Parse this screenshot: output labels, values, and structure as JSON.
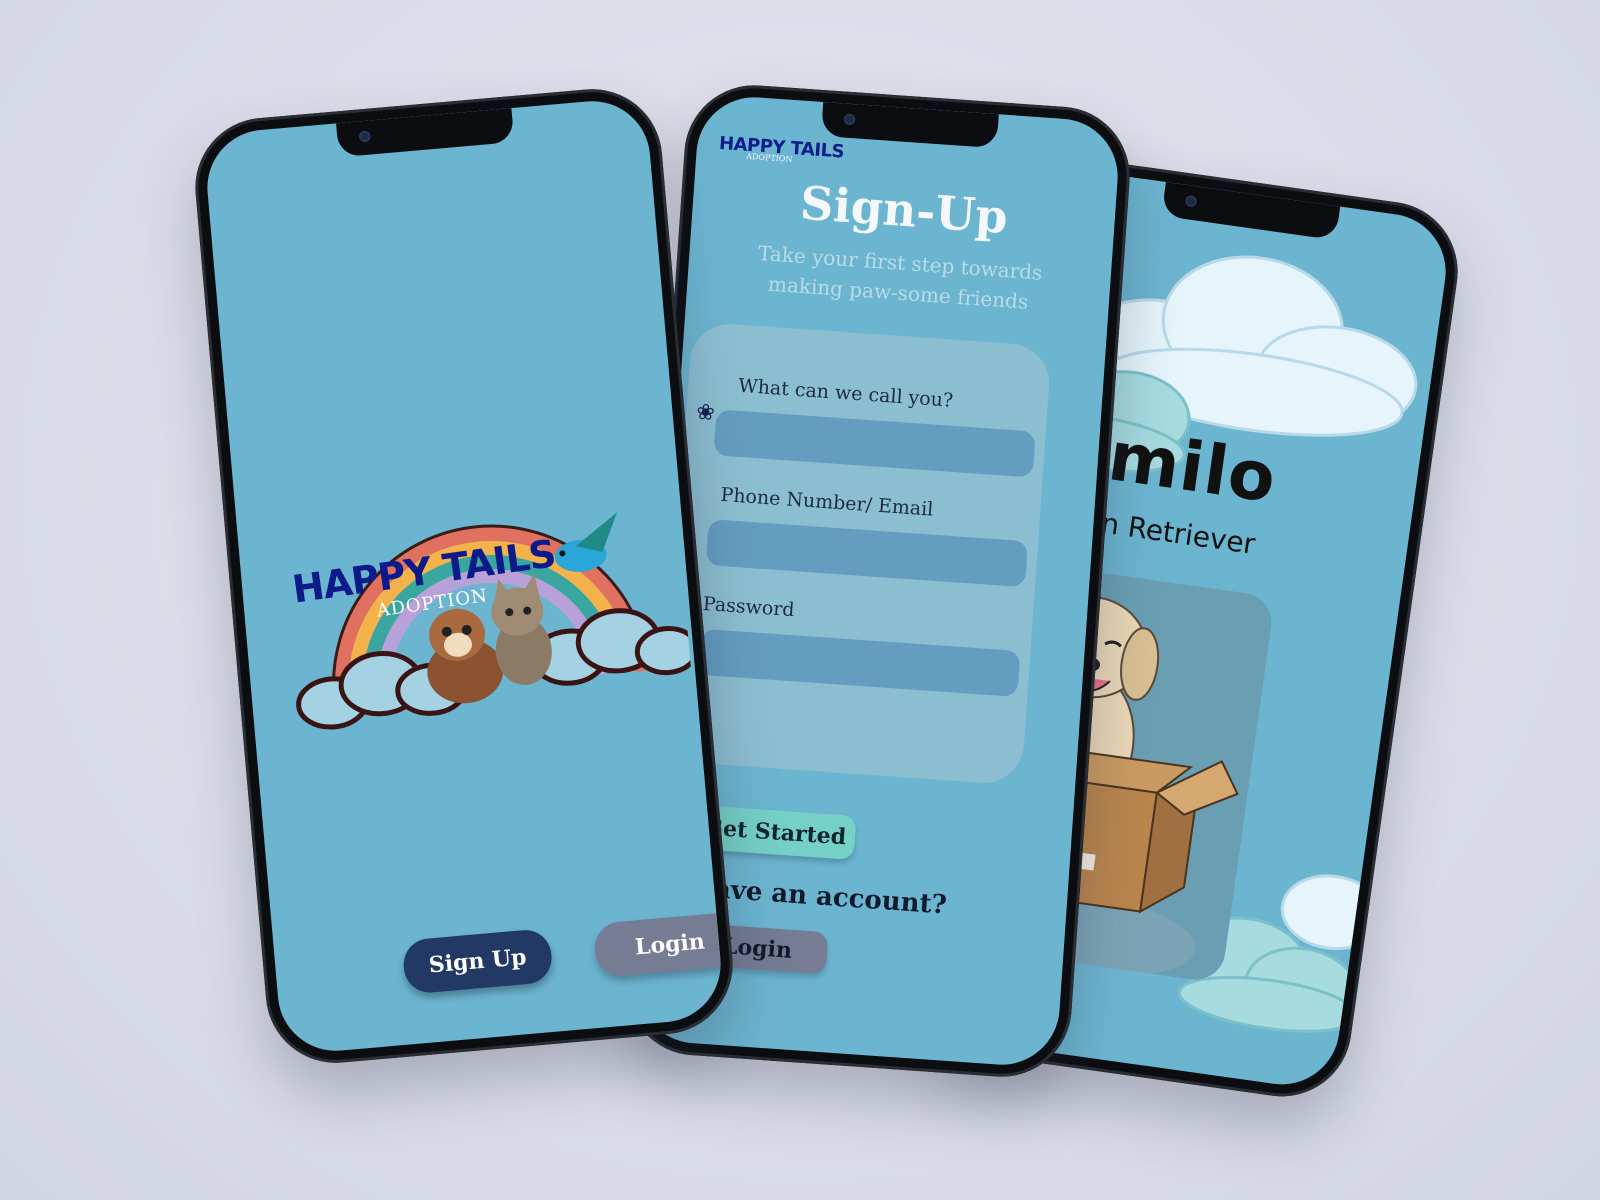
{
  "landing": {
    "brand": "HAPPY TAILS",
    "brand_sub": "ADOPTION",
    "signup_label": "Sign Up",
    "login_label": "Login"
  },
  "signup": {
    "brand": "HAPPY TAILS",
    "brand_sub": "ADOPTION",
    "title": "Sign-Up",
    "subtitle": "Take your first step towards making paw-some friends",
    "fields": [
      {
        "label": "What can we call you?",
        "value": ""
      },
      {
        "label": "Phone Number/ Email",
        "value": ""
      },
      {
        "label": "Password",
        "value": ""
      }
    ],
    "get_started_label": "Get Started",
    "have_account_text": "have an account?",
    "login_label": "Login"
  },
  "pet": {
    "name": "milo",
    "breed": "e Golden Retriever"
  },
  "colors": {
    "screen_bg": "#6cb5d1",
    "brand_blue": "#0d1a8a",
    "signup_button": "#233965",
    "login_button": "#757c93",
    "get_started_button": "#75d0c7"
  },
  "icons": [
    "paw-icon",
    "camera-icon",
    "rainbow-illustration",
    "puppy-illustration",
    "kitten-illustration",
    "bird-illustration",
    "cloud-illustration",
    "golden-retriever-in-box-illustration"
  ]
}
